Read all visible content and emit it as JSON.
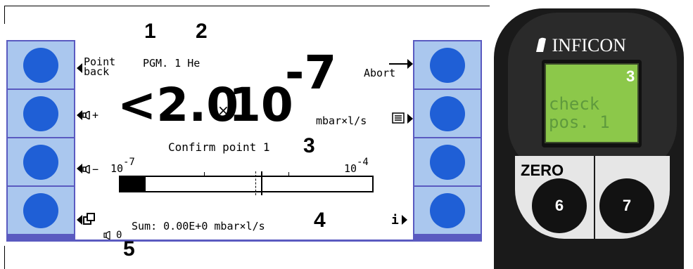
{
  "callouts": {
    "c1": "1",
    "c2": "2",
    "c3": "3",
    "c4": "4",
    "c5": "5"
  },
  "header": {
    "point_back_line1": "Point",
    "point_back_line2": "back",
    "program": "PGM. 1 He",
    "abort": "Abort"
  },
  "reading": {
    "prefix": "<2.0",
    "times": "×",
    "base": "10",
    "exponent": "-7",
    "unit": "mbar×l/s"
  },
  "soft_keys": {
    "vol_plus": "+",
    "vol_minus": "−",
    "info": "i"
  },
  "status": {
    "confirm": "Confirm point 1",
    "sum": "Sum: 0.00E+0 mbar×l/s",
    "volume_value": "0"
  },
  "bar": {
    "left_label_base": "10",
    "left_label_exp": "-7",
    "right_label_base": "10",
    "right_label_exp": "-4",
    "fill_fraction": 0.1,
    "marker_fraction": 0.56
  },
  "device": {
    "brand": "INFICON",
    "screen_line1": "check",
    "screen_line2": "pos. 1",
    "callout_screen": "3",
    "zero_label": "ZERO",
    "btn6": "6",
    "btn7": "7"
  },
  "colors": {
    "frame": "#5a5ac0",
    "key": "#aac7ee",
    "dot": "#1f5fd6",
    "lcd_green": "#8cc84a"
  }
}
